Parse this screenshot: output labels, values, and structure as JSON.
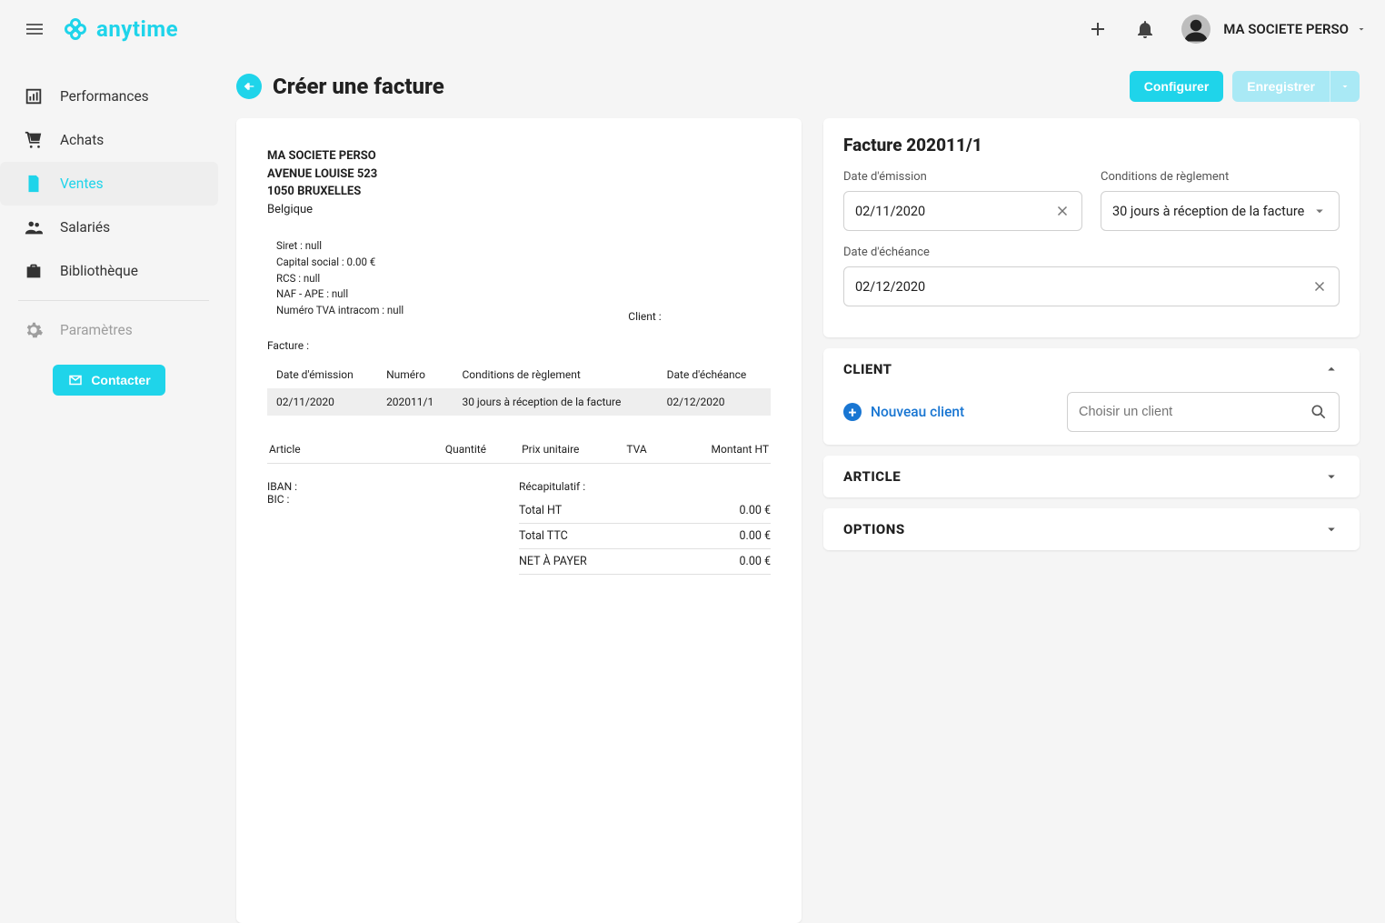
{
  "app": {
    "name": "anytime",
    "account": "MA SOCIETE PERSO"
  },
  "sidebar": {
    "items": [
      {
        "label": "Performances"
      },
      {
        "label": "Achats"
      },
      {
        "label": "Ventes"
      },
      {
        "label": "Salariés"
      },
      {
        "label": "Bibliothèque"
      },
      {
        "label": "Paramètres"
      }
    ],
    "contact_label": "Contacter"
  },
  "header": {
    "title": "Créer une facture",
    "actions": {
      "configure": "Configurer",
      "save": "Enregistrer"
    }
  },
  "invoice_preview": {
    "company": {
      "name": "MA SOCIETE PERSO",
      "address": "AVENUE LOUISE 523",
      "postal_city": "1050 BRUXELLES",
      "country": "Belgique"
    },
    "legal": {
      "siret": "Siret : null",
      "capital": "Capital social : 0.00 €",
      "rcs": "RCS : null",
      "naf": "NAF - APE : null",
      "vat": "Numéro TVA intracom : null"
    },
    "client_label": "Client :",
    "facture_label": "Facture :",
    "table_headers": {
      "emission": "Date d'émission",
      "numero": "Numéro",
      "conditions": "Conditions de règlement",
      "echeance": "Date d'échéance"
    },
    "table_row": {
      "emission": "02/11/2020",
      "numero": "202011/1",
      "conditions": "30 jours à réception de la facture",
      "echeance": "02/12/2020"
    },
    "items_headers": {
      "article": "Article",
      "qty": "Quantité",
      "unit": "Prix unitaire",
      "tva": "TVA",
      "total": "Montant HT"
    },
    "bank": {
      "iban": "IBAN :",
      "bic": "BIC :"
    },
    "recap": {
      "title": "Récapitulatif :",
      "rows": [
        {
          "label": "Total HT",
          "value": "0.00 €"
        },
        {
          "label": "Total TTC",
          "value": "0.00 €"
        },
        {
          "label": "NET À PAYER",
          "value": "0.00 €"
        }
      ]
    }
  },
  "form": {
    "invoice_title": "Facture 202011/1",
    "emission_label": "Date d'émission",
    "emission_value": "02/11/2020",
    "conditions_label": "Conditions de règlement",
    "conditions_value": "30 jours à réception de la facture",
    "echeance_label": "Date d'échéance",
    "echeance_value": "02/12/2020",
    "sections": {
      "client": {
        "title": "CLIENT",
        "new_client": "Nouveau client",
        "search_placeholder": "Choisir un client"
      },
      "article": {
        "title": "ARTICLE"
      },
      "options": {
        "title": "OPTIONS"
      }
    }
  }
}
